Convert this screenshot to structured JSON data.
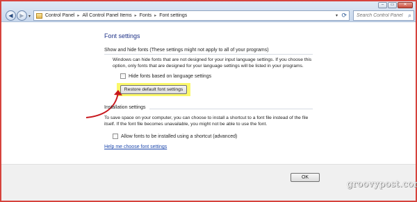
{
  "window": {
    "caption_buttons": {
      "minimize": "–",
      "maximize": "▭",
      "close": "✕"
    }
  },
  "navigation": {
    "back_glyph": "◀",
    "forward_glyph": "▶",
    "history_glyph": "▾",
    "breadcrumbs": [
      "Control Panel",
      "All Control Panel Items",
      "Fonts",
      "Font settings"
    ],
    "separator": "▸",
    "address_dropdown_glyph": "▾",
    "refresh_glyph": "⟳"
  },
  "search": {
    "placeholder": "Search Control Panel",
    "icon_glyph": "⌕"
  },
  "page": {
    "title": "Font settings",
    "show_hide_section": {
      "heading": "Show and hide fonts (These settings might not apply to all of your programs)",
      "description_line1": "Windows can hide fonts that are not designed for your input language settings. If you choose this",
      "description_line2": "option, only fonts that are designed for your language settings will be listed in your programs.",
      "checkbox_label": "Hide fonts based on language settings",
      "checkbox_checked": false,
      "restore_button": "Restore default font settings"
    },
    "installation_section": {
      "heading": "Installation settings",
      "description_line1": "To save space on your computer, you can choose to install a shortcut to a font file instead of the file",
      "description_line2": "itself. If the font file becomes unavailable, you might not be able to use the font.",
      "checkbox_label": "Allow fonts to be installed using a shortcut (advanced)",
      "checkbox_checked": false
    },
    "help_link": "Help me choose font settings"
  },
  "footer": {
    "ok_button": "OK",
    "watermark": "groovypost.com"
  },
  "colors": {
    "highlight": "#fbf86a",
    "annotation_arrow": "#c8171d",
    "link": "#1c47ad",
    "title": "#1e3287"
  }
}
